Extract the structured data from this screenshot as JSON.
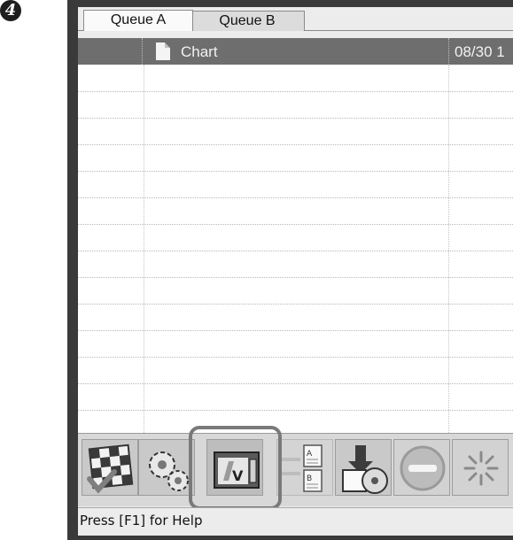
{
  "step_badge": "4",
  "tabs": [
    {
      "label": "Queue A",
      "active": true
    },
    {
      "label": "Queue B",
      "active": false
    }
  ],
  "list_header": {
    "name": "Chart",
    "date": "08/30 1"
  },
  "toolbar": {
    "buttons": [
      {
        "icon": "layout-grid-check-icon"
      },
      {
        "icon": "gear-settings-icon"
      },
      {
        "icon": "print-check-icon",
        "highlighted": true
      },
      {
        "icon": "document-ab-icon"
      },
      {
        "icon": "save-to-disc-icon"
      },
      {
        "icon": "stop-circle-icon"
      },
      {
        "icon": "busy-spinner-icon"
      }
    ]
  },
  "status_bar": {
    "text": "Press [F1] for Help"
  },
  "colors": {
    "header_bg": "#6e6e6e",
    "frame": "#3a3a3a",
    "highlight": "#7a7a7a"
  }
}
